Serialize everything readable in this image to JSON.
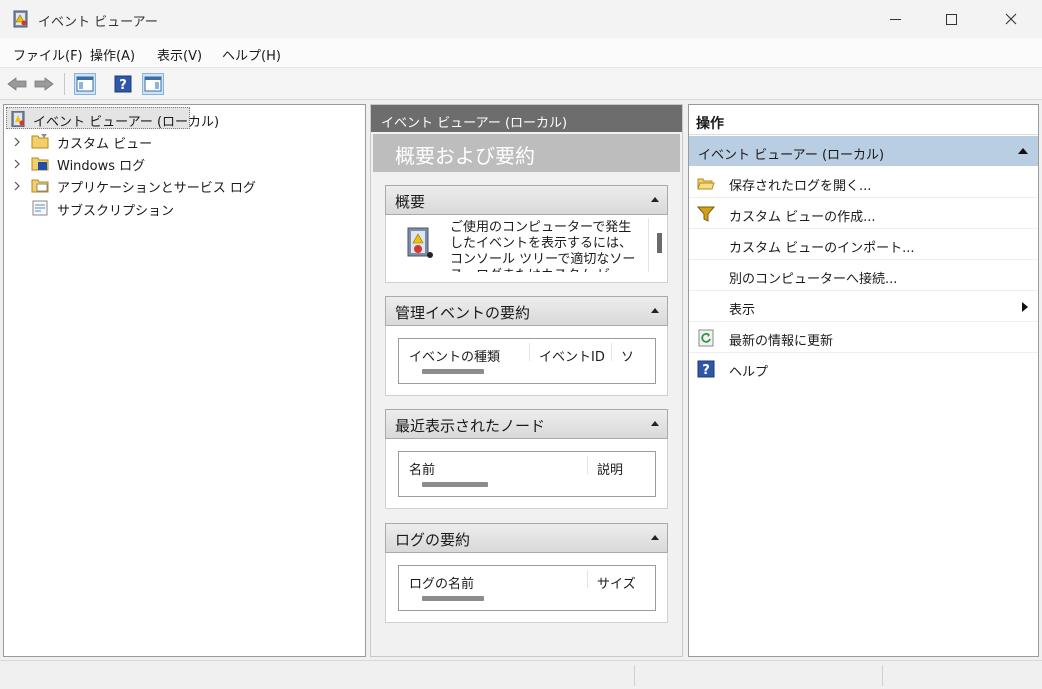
{
  "window": {
    "title": "イベント ビューアー"
  },
  "menu": [
    "ファイル(F)",
    "操作(A)",
    "表示(V)",
    "ヘルプ(H)"
  ],
  "toolbar": {
    "buttons": [
      "back-icon",
      "forward-icon",
      "show-hide-console-tree-icon",
      "help-icon",
      "show-hide-action-pane-icon"
    ]
  },
  "tree": {
    "root": "イベント ビューアー (ローカル)",
    "items": [
      "カスタム ビュー",
      "Windows ログ",
      "アプリケーションとサービス ログ",
      "サブスクリプション"
    ]
  },
  "center": {
    "header": "イベント ビューアー (ローカル)",
    "subheader": "概要および要約",
    "overview": {
      "title": "概要",
      "text": "ご使用のコンピューターで発生したイベントを表示するには、コンソール ツリーで適切なソース、ログまたはカスタム ビュー ノ"
    },
    "admin_events": {
      "title": "管理イベントの要約",
      "columns": [
        "イベントの種類",
        "イベントID",
        "ソ"
      ]
    },
    "recent_nodes": {
      "title": "最近表示されたノード",
      "columns": [
        "名前",
        "説明"
      ]
    },
    "log_summary": {
      "title": "ログの要約",
      "columns": [
        "ログの名前",
        "サイズ"
      ]
    }
  },
  "actions": {
    "header": "操作",
    "group": "イベント ビューアー (ローカル)",
    "items": [
      "保存されたログを開く...",
      "カスタム ビューの作成...",
      "カスタム ビューのインポート...",
      "別のコンピューターへ接続...",
      "表示",
      "最新の情報に更新",
      "ヘルプ"
    ]
  },
  "colors": {
    "action_group_bg": "#b9cde3",
    "center_header_bg": "#6d6d6d",
    "center_subheader_bg": "#bdbdbd"
  }
}
